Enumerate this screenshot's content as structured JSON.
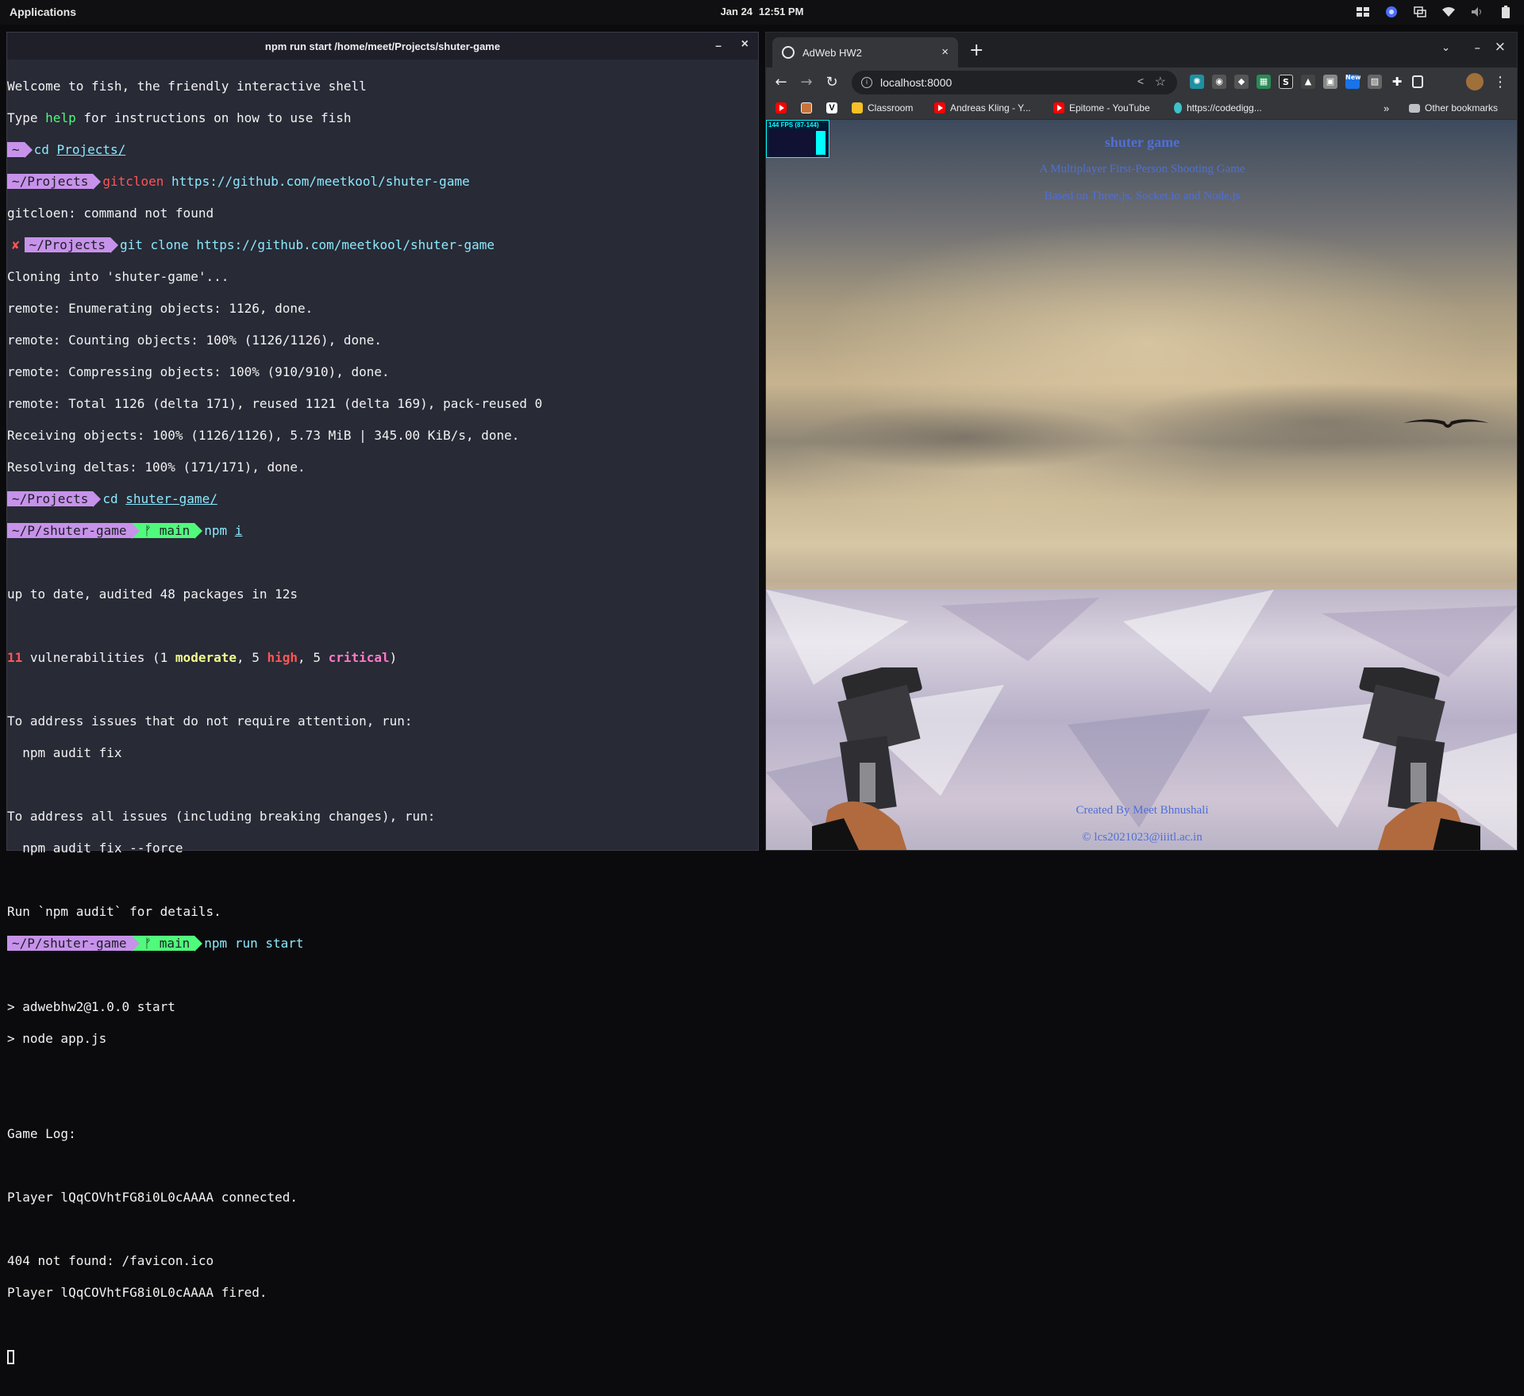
{
  "system_bar": {
    "apps_label": "Applications",
    "date": "Jan 24",
    "time": "12:51 PM",
    "tray_icons": [
      "workspaces-icon",
      "chrome-icon",
      "screen-icon",
      "wifi-icon",
      "volume-icon",
      "battery-icon"
    ]
  },
  "terminal": {
    "title": "npm run start /home/meet/Projects/shuter-game",
    "lines": {
      "l1": "Welcome to fish, the friendly interactive shell",
      "l2a": "Type ",
      "l2b": "help",
      "l2c": " for instructions on how to use fish",
      "p1_dir": "~",
      "p1_cmd": "cd",
      "p1_arg": "Projects/",
      "p2_dir": "~/Projects",
      "p2_cmd": "gitcloen",
      "p2_arg": "https://github.com/meetkool/shuter-game",
      "err1": "gitcloen: command not found",
      "p3_err": "✘",
      "p3_dir": "~/Projects",
      "p3_cmd": "git",
      "p3_arg": "clone https://github.com/meetkool/shuter-game",
      "o1": "Cloning into 'shuter-game'...",
      "o2": "remote: Enumerating objects: 1126, done.",
      "o3": "remote: Counting objects: 100% (1126/1126), done.",
      "o4": "remote: Compressing objects: 100% (910/910), done.",
      "o5": "remote: Total 1126 (delta 171), reused 1121 (delta 169), pack-reused 0",
      "o6": "Receiving objects: 100% (1126/1126), 5.73 MiB | 345.00 KiB/s, done.",
      "o7": "Resolving deltas: 100% (171/171), done.",
      "p4_dir": "~/Projects",
      "p4_cmd": "cd",
      "p4_arg": "shuter-game/",
      "p5_dir": "~/P/shuter-game",
      "p5_branch": "ᚠ main",
      "p5_cmd": "npm",
      "p5_arg": "i",
      "o8": "up to date, audited 48 packages in 12s",
      "v_count": "11",
      "v_a": " vulnerabilities (1 ",
      "v_mod": "moderate",
      "v_b": ", 5 ",
      "v_high": "high",
      "v_c": ", 5 ",
      "v_crit": "critical",
      "v_d": ")",
      "o9": "To address issues that do not require attention, run:",
      "o10": "  npm audit fix",
      "o11": "To address all issues (including breaking changes), run:",
      "o12": "  npm audit fix --force",
      "o13": "Run `npm audit` for details.",
      "p6_dir": "~/P/shuter-game",
      "p6_branch": "ᚠ main",
      "p6_cmd": "npm",
      "p6_arg": "run start",
      "o14": "> adwebhw2@1.0.0 start",
      "o15": "> node app.js",
      "o16": "Game Log:",
      "o17": "Player lQqCOVhtFG8i0L0cAAAA connected.",
      "o18": "404 not found: /favicon.ico",
      "o19": "Player lQqCOVhtFG8i0L0cAAAA fired."
    }
  },
  "browser": {
    "tab_title": "AdWeb HW2",
    "url": "localhost:8000",
    "bookmarks": [
      "Classroom",
      "Andreas Kling - Y...",
      "Epitome - YouTube",
      "https://codedigg..."
    ],
    "overflow": "»",
    "other_bookmarks": "Other bookmarks",
    "ext_new_badge": "New"
  },
  "game": {
    "fps_label": "144 FPS (87-144)",
    "title": "shuter game",
    "subtitle": "A Multiplayer First-Person Shooting Game",
    "based_on": "Based on Three.js, Socket.io and Node.js",
    "credit": "Created By Meet Bhnushali",
    "email": "© lcs2021023@iiitl.ac.in"
  },
  "colors": {
    "terminal_bg": "#282a36",
    "prompt_dir": "#c792ea",
    "prompt_git": "#50fa7b",
    "command": "#8be9fd",
    "error": "#ff5555",
    "game_text": "#4f6fd6"
  }
}
